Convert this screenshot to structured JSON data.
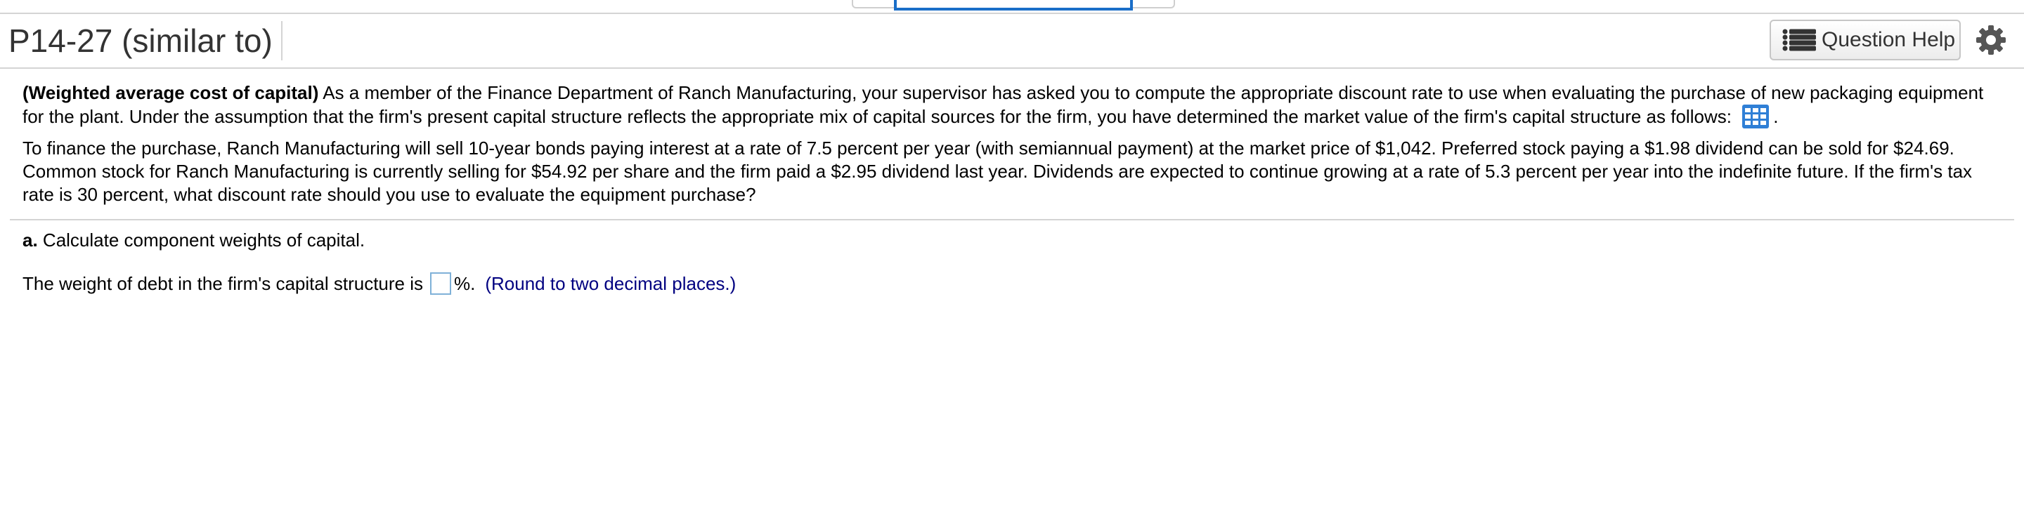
{
  "header": {
    "title": "P14-27 (similar to)",
    "help_label": "Question Help"
  },
  "problem": {
    "intro_title": "(Weighted average cost of capital)",
    "intro_text": "As a member of the Finance Department of Ranch Manufacturing, your supervisor has asked you to compute the appropriate discount rate to use when evaluating the purchase of new packaging equipment for the plant.  Under the assumption that the firm's present capital structure reflects the appropriate mix of capital sources for the firm, you have determined the market value of the firm's capital structure as follows:",
    "intro_after_icon": ".",
    "details": "To finance the purchase, Ranch Manufacturing will sell 10-year bonds paying interest at a rate of 7.5 percent per year (with semiannual payment) at the market price of $1,042.  Preferred stock paying a $1.98 dividend can be sold for $24.69.  Common stock for Ranch Manufacturing is currently selling for $54.92 per share and the firm paid a $2.95 dividend last year.  Dividends are expected to continue growing at a rate of 5.3 percent per year into the indefinite future.  If the firm's tax rate is 30 percent, what discount rate should you use to evaluate the equipment purchase?"
  },
  "part_a": {
    "letter": "a.",
    "text": "Calculate component weights of capital."
  },
  "question": {
    "prefix": "The weight of debt in the firm's capital structure is",
    "answer_value": "",
    "suffix": "%.",
    "hint": "(Round to two decimal places.)"
  },
  "icons": {
    "help": "list-icon",
    "settings": "gear-icon",
    "data_table": "table-grid-icon"
  },
  "colors": {
    "accent_blue": "#1a6ec8",
    "hint_navy": "#000080",
    "input_border": "#7fb1d8"
  }
}
